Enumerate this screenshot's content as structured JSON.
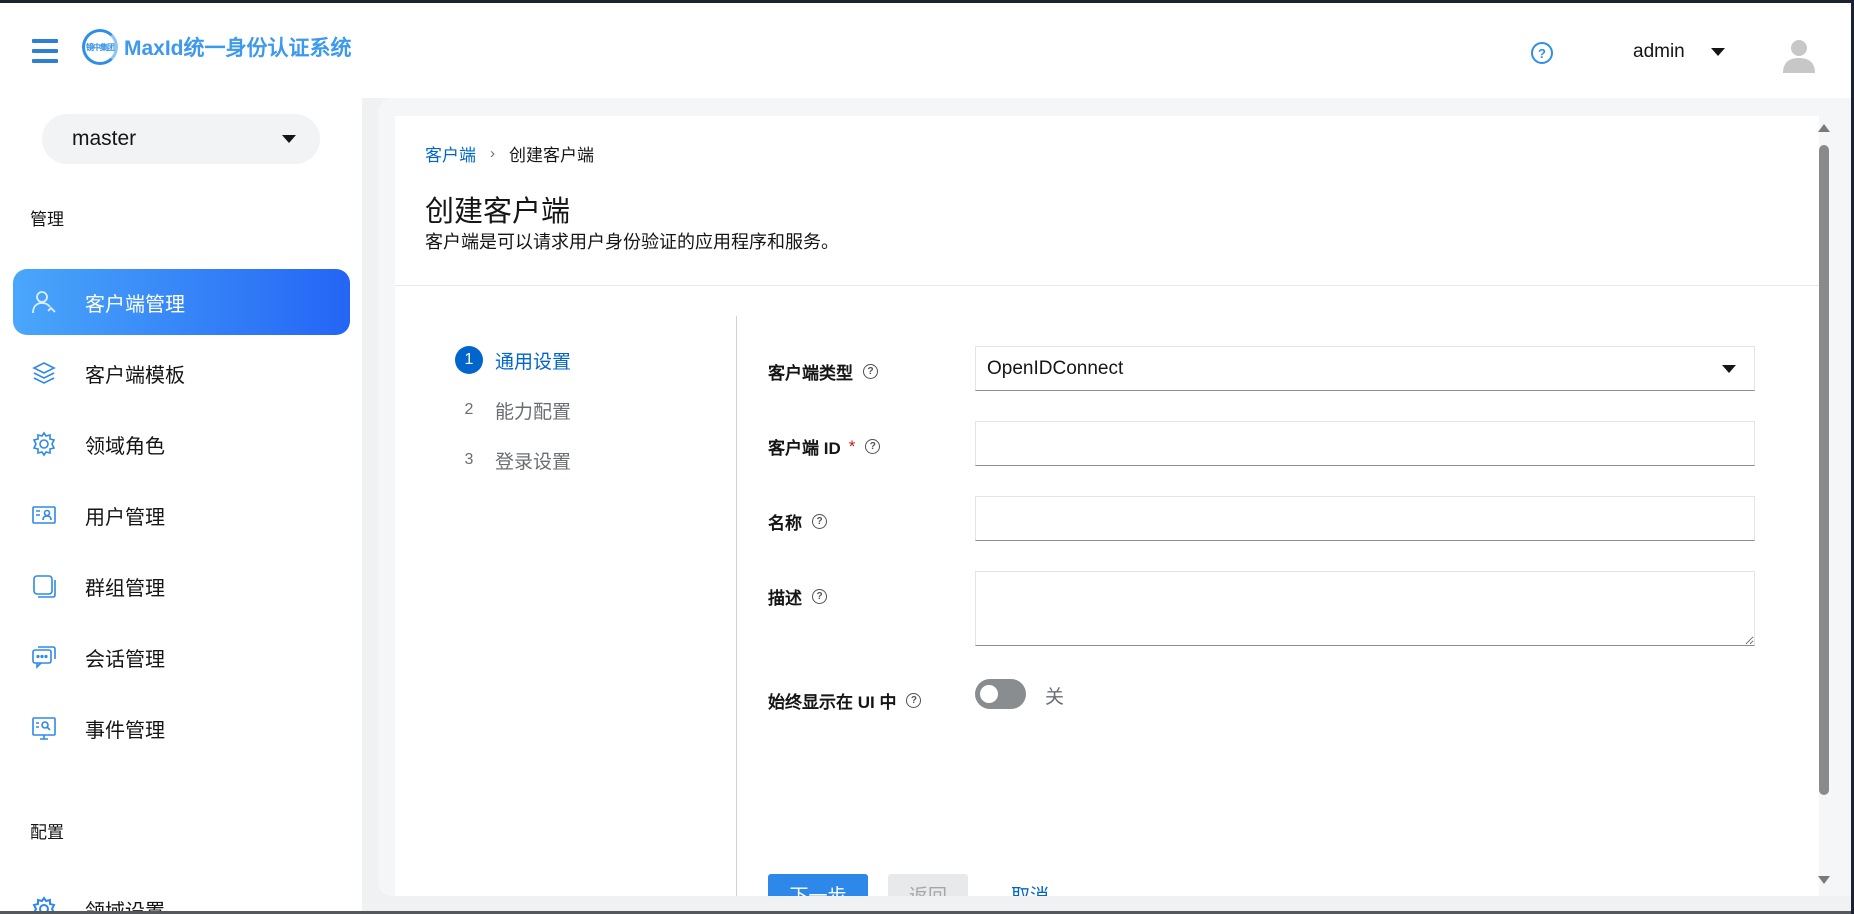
{
  "header": {
    "brand_logo_text": "镜中集团",
    "brand_title": "MaxId统一身份认证系统",
    "help_icon": "question-circle-icon",
    "username": "admin",
    "avatar_icon": "user-avatar-icon",
    "accent_color": "#2f8fe6"
  },
  "sidebar": {
    "realm": "master",
    "sections": {
      "manage": "管理",
      "configure": "配置"
    },
    "items": [
      {
        "label": "客户端管理",
        "icon": "user-outline-icon",
        "active": true
      },
      {
        "label": "客户端模板",
        "icon": "layers-icon",
        "active": false
      },
      {
        "label": "领域角色",
        "icon": "gear-icon",
        "active": false
      },
      {
        "label": "用户管理",
        "icon": "id-card-icon",
        "active": false
      },
      {
        "label": "群组管理",
        "icon": "group-square-icon",
        "active": false
      },
      {
        "label": "会话管理",
        "icon": "chat-bubble-icon",
        "active": false
      },
      {
        "label": "事件管理",
        "icon": "event-screen-icon",
        "active": false
      },
      {
        "label": "领域设置",
        "icon": "settings-gear-icon",
        "active": false
      }
    ],
    "active_gradient": [
      "#4aa7fa",
      "#2465f5"
    ]
  },
  "breadcrumb": {
    "parent": "客户端",
    "current": "创建客户端"
  },
  "page": {
    "title": "创建客户端",
    "description": "客户端是可以请求用户身份验证的应用程序和服务。"
  },
  "wizard": {
    "steps": [
      {
        "num": "1",
        "label": "通用设置",
        "active": true
      },
      {
        "num": "2",
        "label": "能力配置",
        "active": false
      },
      {
        "num": "3",
        "label": "登录设置",
        "active": false
      }
    ]
  },
  "form": {
    "client_type": {
      "label": "客户端类型",
      "value": "OpenIDConnect"
    },
    "client_id": {
      "label": "客户端 ID",
      "required_mark": "*",
      "value": ""
    },
    "name": {
      "label": "名称",
      "value": ""
    },
    "description": {
      "label": "描述",
      "value": ""
    },
    "always_display": {
      "label": "始终显示在 UI 中",
      "state_text": "关",
      "on": false
    }
  },
  "buttons": {
    "next": "下一步",
    "back": "返回",
    "cancel": "取消"
  }
}
